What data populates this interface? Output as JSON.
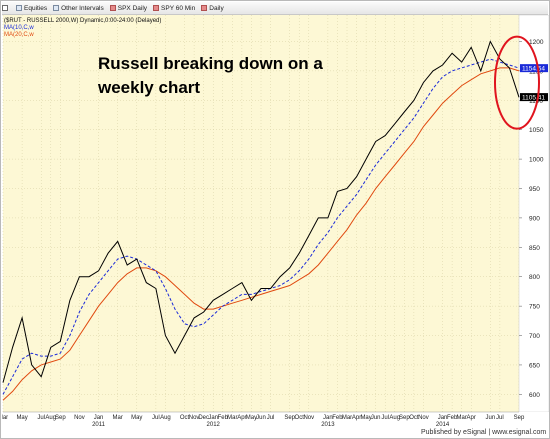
{
  "toolbar": {
    "items": [
      {
        "icon": "chevron-icon",
        "label": ""
      },
      {
        "icon": "list-icon",
        "label": "Equities"
      },
      {
        "icon": "list-icon",
        "label": "Other Intervals"
      },
      {
        "icon": "chart-icon",
        "label": "SPX Daily"
      },
      {
        "icon": "chart-icon",
        "label": "SPY 60 Min"
      },
      {
        "icon": "chart-icon",
        "label": "Daily"
      }
    ]
  },
  "chart_data": {
    "type": "line",
    "title": "($RUT - RUSSELL 2000,W) Dynamic,0:00-24:00 (Delayed)",
    "legend": [
      {
        "label": "MA(10,C,w",
        "color": "#1a2ad8"
      },
      {
        "label": "MA(20,C,w",
        "color": "#e04a10"
      }
    ],
    "annotation": "Russell breaking down on a weekly chart",
    "colors": {
      "plot_bg": "#fdf8d5",
      "grid": "#d6d0a4",
      "price": "#000000",
      "ma10": "#1a2ad8",
      "ma20": "#e04a10",
      "circle": "#e0141e"
    },
    "ylim": [
      570,
      1245
    ],
    "yticks": [
      600,
      650,
      700,
      750,
      800,
      850,
      900,
      950,
      1000,
      1050,
      1100,
      1150,
      1200
    ],
    "price_tags": [
      {
        "value": 1154.64,
        "label": "1154.64",
        "bg": "#1a2ad8"
      },
      {
        "value": 1105.41,
        "label": "1105.41",
        "bg": "#000000"
      }
    ],
    "xticks": [
      {
        "pos": 0,
        "label": "Mar"
      },
      {
        "pos": 2,
        "label": "May"
      },
      {
        "pos": 4,
        "label": "Jul"
      },
      {
        "pos": 5,
        "label": "Aug"
      },
      {
        "pos": 6,
        "label": "Sep"
      },
      {
        "pos": 8,
        "label": "Nov"
      },
      {
        "pos": 10,
        "label": "Jan"
      },
      {
        "pos": 12,
        "label": "Mar"
      },
      {
        "pos": 14,
        "label": "May"
      },
      {
        "pos": 16,
        "label": "Jul"
      },
      {
        "pos": 17,
        "label": "Aug"
      },
      {
        "pos": 19,
        "label": "Oct"
      },
      {
        "pos": 20,
        "label": "Nov"
      },
      {
        "pos": 21,
        "label": "Dec"
      },
      {
        "pos": 22,
        "label": "Jan"
      },
      {
        "pos": 23,
        "label": "Feb"
      },
      {
        "pos": 24,
        "label": "Mar"
      },
      {
        "pos": 25,
        "label": "Apr"
      },
      {
        "pos": 26,
        "label": "May"
      },
      {
        "pos": 27,
        "label": "Jun"
      },
      {
        "pos": 28,
        "label": "Jul"
      },
      {
        "pos": 30,
        "label": "Sep"
      },
      {
        "pos": 31,
        "label": "Oct"
      },
      {
        "pos": 32,
        "label": "Nov"
      },
      {
        "pos": 34,
        "label": "Jan"
      },
      {
        "pos": 35,
        "label": "Feb"
      },
      {
        "pos": 36,
        "label": "Mar"
      },
      {
        "pos": 37,
        "label": "Apr"
      },
      {
        "pos": 38,
        "label": "May"
      },
      {
        "pos": 39,
        "label": "Jun"
      },
      {
        "pos": 40,
        "label": "Jul"
      },
      {
        "pos": 41,
        "label": "Aug"
      },
      {
        "pos": 42,
        "label": "Sep"
      },
      {
        "pos": 43,
        "label": "Oct"
      },
      {
        "pos": 44,
        "label": "Nov"
      },
      {
        "pos": 46,
        "label": "Jan"
      },
      {
        "pos": 47,
        "label": "Feb"
      },
      {
        "pos": 48,
        "label": "Mar"
      },
      {
        "pos": 49,
        "label": "Apr"
      },
      {
        "pos": 51,
        "label": "Jun"
      },
      {
        "pos": 52,
        "label": "Jul"
      },
      {
        "pos": 54,
        "label": "Sep"
      }
    ],
    "year_labels": [
      {
        "pos": 10,
        "label": "2011"
      },
      {
        "pos": 22,
        "label": "2012"
      },
      {
        "pos": 34,
        "label": "2013"
      },
      {
        "pos": 46,
        "label": "2014"
      }
    ],
    "x": [
      0,
      1,
      2,
      3,
      4,
      5,
      6,
      7,
      8,
      9,
      10,
      11,
      12,
      13,
      14,
      15,
      16,
      17,
      18,
      19,
      20,
      21,
      22,
      23,
      24,
      25,
      26,
      27,
      28,
      29,
      30,
      31,
      32,
      33,
      34,
      35,
      36,
      37,
      38,
      39,
      40,
      41,
      42,
      43,
      44,
      45,
      46,
      47,
      48,
      49,
      50,
      51,
      52,
      53,
      54
    ],
    "series": [
      {
        "name": "price",
        "values": [
          620,
          680,
          730,
          650,
          630,
          680,
          690,
          760,
          800,
          800,
          810,
          840,
          860,
          820,
          830,
          790,
          780,
          700,
          670,
          700,
          730,
          740,
          760,
          770,
          780,
          790,
          760,
          780,
          780,
          800,
          815,
          840,
          870,
          900,
          900,
          945,
          950,
          970,
          1000,
          1030,
          1040,
          1060,
          1080,
          1100,
          1130,
          1150,
          1160,
          1180,
          1165,
          1190,
          1150,
          1200,
          1170,
          1155,
          1105
        ]
      },
      {
        "name": "MA(10,C,w",
        "values": [
          600,
          630,
          660,
          670,
          665,
          665,
          670,
          700,
          740,
          770,
          790,
          810,
          830,
          835,
          830,
          820,
          810,
          780,
          745,
          720,
          715,
          720,
          735,
          750,
          760,
          770,
          770,
          775,
          780,
          785,
          795,
          810,
          830,
          855,
          875,
          900,
          920,
          940,
          965,
          990,
          1010,
          1030,
          1050,
          1070,
          1095,
          1120,
          1140,
          1150,
          1155,
          1160,
          1165,
          1170,
          1165,
          1160,
          1154.64
        ]
      },
      {
        "name": "MA(20,C,w",
        "values": [
          590,
          605,
          625,
          640,
          650,
          655,
          660,
          675,
          700,
          725,
          750,
          770,
          790,
          805,
          815,
          815,
          810,
          800,
          785,
          770,
          755,
          745,
          745,
          750,
          755,
          760,
          765,
          770,
          775,
          780,
          785,
          795,
          805,
          820,
          840,
          860,
          880,
          905,
          925,
          950,
          970,
          990,
          1010,
          1030,
          1055,
          1075,
          1095,
          1110,
          1125,
          1135,
          1145,
          1150,
          1155,
          1155,
          1150
        ]
      }
    ]
  },
  "footer": "Published by eSignal | www.esignal.com"
}
